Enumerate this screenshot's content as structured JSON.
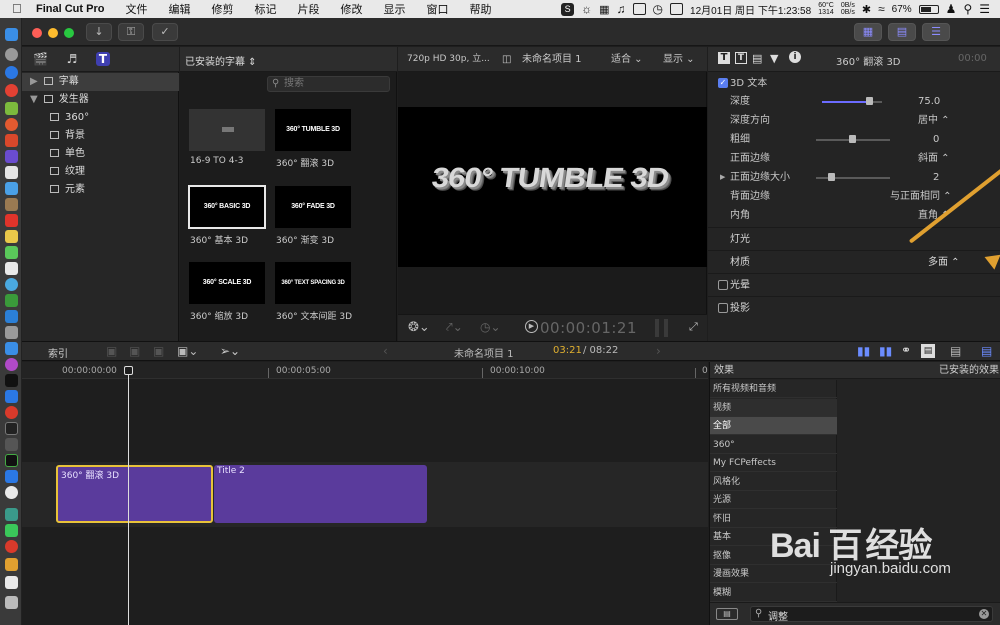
{
  "menubar": {
    "app_name": "Final Cut Pro",
    "items": [
      "文件",
      "编辑",
      "修剪",
      "标记",
      "片段",
      "修改",
      "显示",
      "窗口",
      "帮助"
    ],
    "cpu_temp": "60°C",
    "fan": "1314",
    "net_up": "0B/s",
    "net_down": "0B/s",
    "battery": "67%",
    "clock": "12月01日 周日 下午1:23:58"
  },
  "library": {
    "items": [
      {
        "label": "字幕",
        "selected": true
      },
      {
        "label": "发生器"
      },
      {
        "label": "360°"
      },
      {
        "label": "背景"
      },
      {
        "label": "单色"
      },
      {
        "label": "纹理"
      },
      {
        "label": "元素"
      }
    ]
  },
  "browser": {
    "title": "已安装的字幕",
    "search_placeholder": "搜索",
    "thumbs": [
      {
        "text": "",
        "label": "16-9 TO 4-3"
      },
      {
        "text": "360° TUMBLE 3D",
        "label": "360° 翻滚 3D"
      },
      {
        "text": "360° BASIC 3D",
        "label": "360° 基本 3D",
        "selected": true
      },
      {
        "text": "360° FADE 3D",
        "label": "360° 渐变 3D"
      },
      {
        "text": "360° SCALE 3D",
        "label": "360° 缩放 3D"
      },
      {
        "text": "360° TEXT SPACING 3D",
        "label": "360° 文本间距 3D"
      }
    ]
  },
  "viewer": {
    "format": "720p HD 30p, 立...",
    "project": "未命名项目 1",
    "fit": "适合",
    "display": "显示",
    "canvas_text": "360° TUMBLE 3D",
    "timecode": "00:00:01:21"
  },
  "inspector": {
    "title": "360° 翻滚 3D",
    "title_extra": "00:00",
    "section_3d": "3D 文本",
    "rows": [
      {
        "label": "深度",
        "value": "75.0"
      },
      {
        "label": "深度方向",
        "value": "居中 ⌃"
      },
      {
        "label": "粗细",
        "value": "0"
      },
      {
        "label": "正面边缘",
        "value": "斜面 ⌃"
      },
      {
        "label": "正面边缘大小",
        "value": "2"
      },
      {
        "label": "背面边缘",
        "value": "与正面相同 ⌃"
      },
      {
        "label": "内角",
        "value": "直角 ⌃"
      }
    ],
    "lighting": "灯光",
    "material": "材质",
    "material_value": "多面 ⌃",
    "glow": "光晕",
    "shadow": "投影"
  },
  "timeline_bar": {
    "index": "索引",
    "project": "未命名项目 1",
    "position": "03:21",
    "duration": "/ 08:22"
  },
  "timeline": {
    "ruler": [
      "00:00:00:00",
      "00:00:05:00",
      "00:00:10:00",
      "0"
    ],
    "clips": [
      {
        "label": "360° 翻滚 3D"
      },
      {
        "label": "Title 2"
      }
    ]
  },
  "effects": {
    "header": "效果",
    "right_header": "已安装的效果",
    "items": [
      {
        "label": "所有视频和音频"
      },
      {
        "label": "视频"
      },
      {
        "label": "全部",
        "selected": true
      },
      {
        "label": "360°"
      },
      {
        "label": "My FCPeffects"
      },
      {
        "label": "风格化"
      },
      {
        "label": "光源"
      },
      {
        "label": "怀旧"
      },
      {
        "label": "基本"
      },
      {
        "label": "抠像"
      },
      {
        "label": "漫画效果"
      },
      {
        "label": "模糊"
      }
    ],
    "search_value": "调整"
  },
  "watermark": {
    "brand": "Bai  百",
    "brand2": "经验",
    "url": "jingyan.baidu.com"
  }
}
